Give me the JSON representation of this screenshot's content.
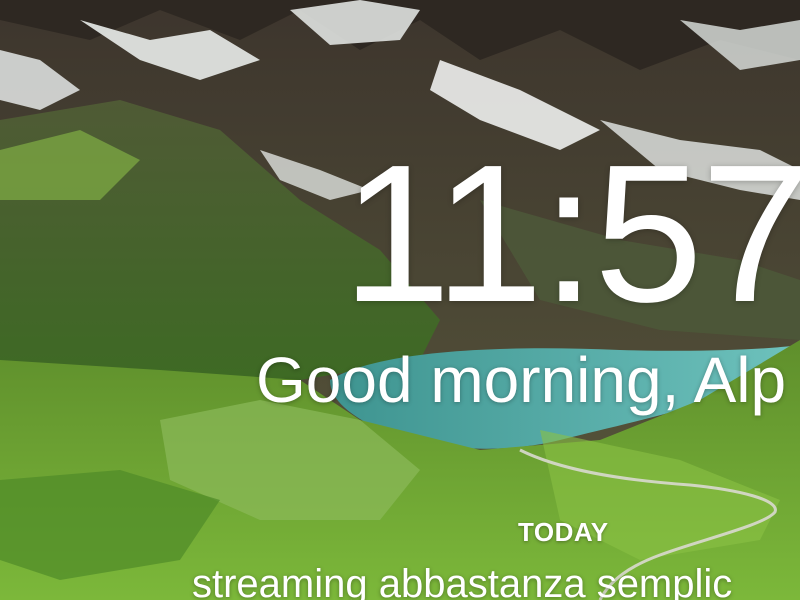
{
  "background": {
    "scene": "alpine-lake-mountains",
    "colors": {
      "sky_rock": "#4a4137",
      "snow": "#eef0ee",
      "lake": "#4fa8a4",
      "grass": "#6fa332",
      "grass_dark": "#3f6b22"
    }
  },
  "clock": {
    "time": "11:57"
  },
  "greeting": {
    "text": "Good morning, Alp"
  },
  "focus": {
    "label": "TODAY",
    "text": "streaming abbastanza semplic"
  }
}
